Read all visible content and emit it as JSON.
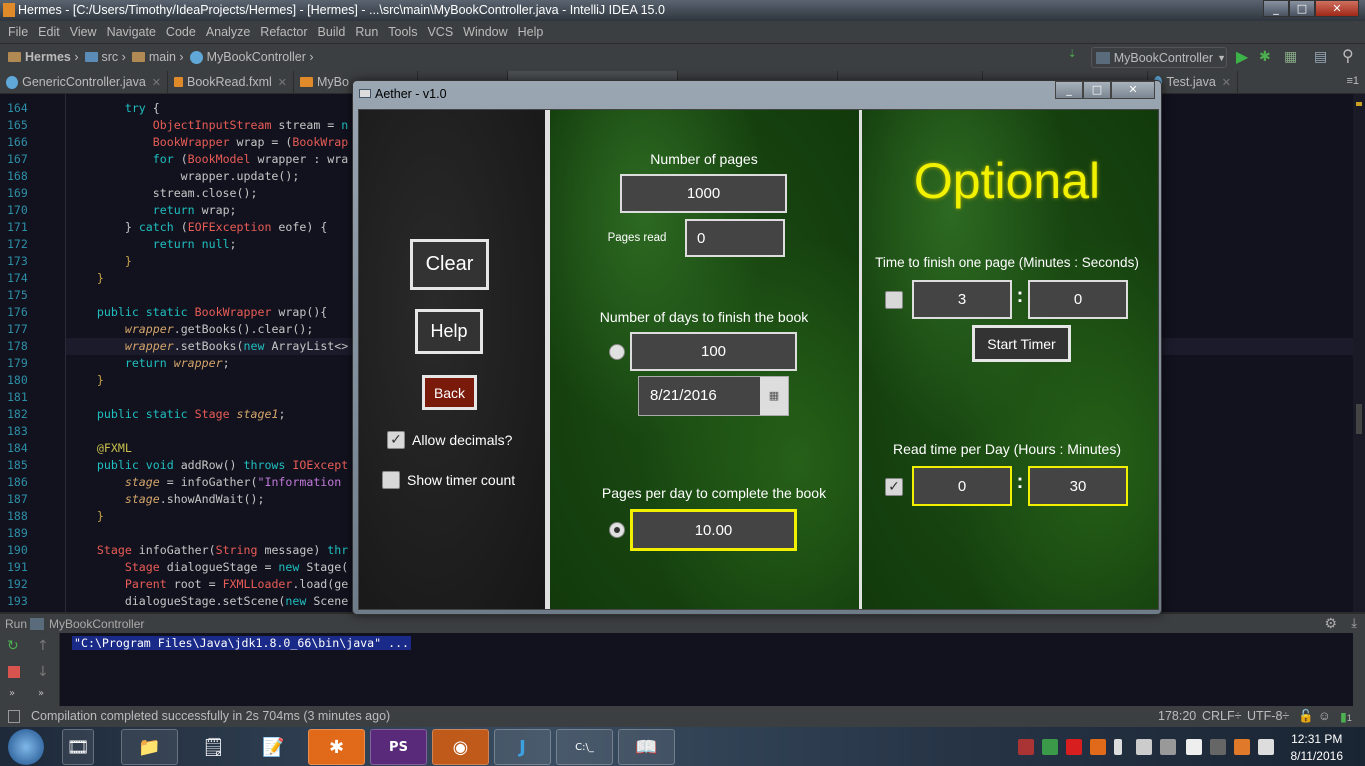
{
  "ide": {
    "title": "Hermes - [C:/Users/Timothy/IdeaProjects/Hermes] - [Hermes] - ...\\src\\main\\MyBookController.java - IntelliJ IDEA 15.0",
    "menu": [
      "File",
      "Edit",
      "View",
      "Navigate",
      "Code",
      "Analyze",
      "Refactor",
      "Build",
      "Run",
      "Tools",
      "VCS",
      "Window",
      "Help"
    ],
    "breadcrumb": [
      "Hermes",
      "src",
      "main",
      "MyBookController"
    ],
    "run_config": "MyBookController",
    "tabs": [
      {
        "label": "GenericController.java"
      },
      {
        "label": "BookRead.fxml"
      },
      {
        "label": "MyBo"
      },
      {
        "label": ""
      },
      {
        "label": ""
      },
      {
        "label": ""
      },
      {
        "label": ""
      },
      {
        "label": ""
      },
      {
        "label": "Test.java"
      }
    ],
    "tab_overflow": "≡1",
    "code": {
      "current_line": 178,
      "lines": [
        {
          "n": 164,
          "t": [
            [
              "        ",
              "df"
            ],
            [
              "try ",
              "kw"
            ],
            [
              "{",
              "df"
            ]
          ]
        },
        {
          "n": 165,
          "t": [
            [
              "            ",
              "df"
            ],
            [
              "ObjectInputStream",
              "ty"
            ],
            [
              " stream = ",
              "df"
            ],
            [
              "n",
              "kw"
            ]
          ]
        },
        {
          "n": 166,
          "t": [
            [
              "            ",
              "df"
            ],
            [
              "BookWrapper",
              "ty"
            ],
            [
              " wrap = (",
              "df"
            ],
            [
              "BookWrap",
              "ty"
            ]
          ]
        },
        {
          "n": 167,
          "t": [
            [
              "            ",
              "df"
            ],
            [
              "for ",
              "kw"
            ],
            [
              "(",
              "df"
            ],
            [
              "BookModel",
              "ty"
            ],
            [
              " wrapper : wra",
              "df"
            ]
          ]
        },
        {
          "n": 168,
          "t": [
            [
              "                wrapper.update();",
              "df"
            ]
          ]
        },
        {
          "n": 169,
          "t": [
            [
              "            stream.close();",
              "df"
            ]
          ]
        },
        {
          "n": 170,
          "t": [
            [
              "            ",
              "df"
            ],
            [
              "return ",
              "kw"
            ],
            [
              "wrap;",
              "df"
            ]
          ]
        },
        {
          "n": 171,
          "t": [
            [
              "        } ",
              "df"
            ],
            [
              "catch ",
              "kw"
            ],
            [
              "(",
              "df"
            ],
            [
              "EOFException",
              "ty"
            ],
            [
              " eofe) {",
              "df"
            ]
          ]
        },
        {
          "n": 172,
          "t": [
            [
              "            ",
              "df"
            ],
            [
              "return null",
              "kw"
            ],
            [
              ";",
              "df"
            ]
          ]
        },
        {
          "n": 173,
          "t": [
            [
              "        }",
              "br"
            ]
          ]
        },
        {
          "n": 174,
          "t": [
            [
              "    }",
              "br"
            ]
          ]
        },
        {
          "n": 175,
          "t": []
        },
        {
          "n": 176,
          "t": [
            [
              "    ",
              "df"
            ],
            [
              "public static ",
              "kw"
            ],
            [
              "BookWrapper",
              "ty"
            ],
            [
              " wrap(){",
              "df"
            ]
          ]
        },
        {
          "n": 177,
          "t": [
            [
              "        ",
              "df"
            ],
            [
              "wrapper",
              "it"
            ],
            [
              ".getBooks().clear();",
              "df"
            ]
          ]
        },
        {
          "n": 178,
          "t": [
            [
              "        ",
              "df"
            ],
            [
              "wrapper",
              "it"
            ],
            [
              ".setBooks(",
              "df"
            ],
            [
              "new ",
              "kw"
            ],
            [
              "ArrayList<>",
              "df"
            ]
          ]
        },
        {
          "n": 179,
          "t": [
            [
              "        ",
              "df"
            ],
            [
              "return ",
              "kw"
            ],
            [
              "wrapper",
              "it"
            ],
            [
              ";",
              "df"
            ]
          ]
        },
        {
          "n": 180,
          "t": [
            [
              "    }",
              "br"
            ]
          ]
        },
        {
          "n": 181,
          "t": []
        },
        {
          "n": 182,
          "t": [
            [
              "    ",
              "df"
            ],
            [
              "public static ",
              "kw"
            ],
            [
              "Stage",
              "ty"
            ],
            [
              " ",
              "df"
            ],
            [
              "stage1",
              "it"
            ],
            [
              ";",
              "df"
            ]
          ]
        },
        {
          "n": 183,
          "t": []
        },
        {
          "n": 184,
          "t": [
            [
              "    ",
              "df"
            ],
            [
              "@FXML",
              "an"
            ]
          ]
        },
        {
          "n": 185,
          "t": [
            [
              "    ",
              "df"
            ],
            [
              "public void ",
              "kw"
            ],
            [
              "addRow() ",
              "df"
            ],
            [
              "throws ",
              "kw"
            ],
            [
              "IOExcept",
              "ty"
            ]
          ]
        },
        {
          "n": 186,
          "t": [
            [
              "        ",
              "df"
            ],
            [
              "stage",
              "it"
            ],
            [
              " = infoGather(",
              "df"
            ],
            [
              "\"Information ",
              "st"
            ]
          ]
        },
        {
          "n": 187,
          "t": [
            [
              "        ",
              "df"
            ],
            [
              "stage",
              "it"
            ],
            [
              ".showAndWait();",
              "df"
            ]
          ]
        },
        {
          "n": 188,
          "t": [
            [
              "    }",
              "br"
            ]
          ]
        },
        {
          "n": 189,
          "t": []
        },
        {
          "n": 190,
          "t": [
            [
              "    ",
              "df"
            ],
            [
              "Stage",
              "ty"
            ],
            [
              " infoGather(",
              "df"
            ],
            [
              "String",
              "ty"
            ],
            [
              " message) ",
              "df"
            ],
            [
              "thr",
              "kw"
            ]
          ]
        },
        {
          "n": 191,
          "t": [
            [
              "        ",
              "df"
            ],
            [
              "Stage",
              "ty"
            ],
            [
              " dialogueStage = ",
              "df"
            ],
            [
              "new ",
              "kw"
            ],
            [
              "Stage(",
              "df"
            ]
          ]
        },
        {
          "n": 192,
          "t": [
            [
              "        ",
              "df"
            ],
            [
              "Parent",
              "ty"
            ],
            [
              " root = ",
              "df"
            ],
            [
              "FXMLLoader",
              "ty"
            ],
            [
              ".load(ge",
              "df"
            ]
          ]
        },
        {
          "n": 193,
          "t": [
            [
              "        dialogueStage.setScene(",
              "df"
            ],
            [
              "new ",
              "kw"
            ],
            [
              "Scene",
              "df"
            ]
          ]
        }
      ]
    },
    "run": {
      "label": "Run",
      "config": "MyBookController",
      "console": "\"C:\\Program Files\\Java\\jdk1.8.0_66\\bin\\java\" ..."
    },
    "status": {
      "message": "Compilation completed successfully in 2s 704ms (3 minutes ago)",
      "position": "178:20",
      "line_sep": "CRLF÷",
      "encoding": "UTF-8÷",
      "notifications": "1"
    }
  },
  "dialog": {
    "title": "Aether - v1.0",
    "left": {
      "clear": "Clear",
      "help": "Help",
      "back": "Back",
      "allow_decimals": "Allow decimals?",
      "allow_decimals_checked": true,
      "show_timer": "Show timer count",
      "show_timer_checked": false
    },
    "middle": {
      "pages_label": "Number of pages",
      "pages_value": "1000",
      "pages_read_label": "Pages read",
      "pages_read_value": "0",
      "days_label": "Number of days to finish the book",
      "days_value": "100",
      "days_selected": false,
      "date_value": "8/21/2016",
      "ppd_label": "Pages per day to complete the book",
      "ppd_value": "10.00",
      "ppd_selected": true
    },
    "right": {
      "heading": "Optional",
      "time_label": "Time to finish one page (Minutes : Seconds)",
      "time_checked": false,
      "minutes": "3",
      "seconds": "0",
      "colon": ":",
      "start_timer": "Start Timer",
      "read_label": "Read time per Day (Hours : Minutes)",
      "read_checked": true,
      "hours": "0",
      "read_minutes": "30"
    },
    "colors": {
      "highlight_border": "#f0f000",
      "back_button": "#7a1a0a",
      "optional_text": "#f2f200"
    }
  },
  "taskbar": {
    "clock_time": "12:31 PM",
    "clock_date": "8/11/2016"
  }
}
